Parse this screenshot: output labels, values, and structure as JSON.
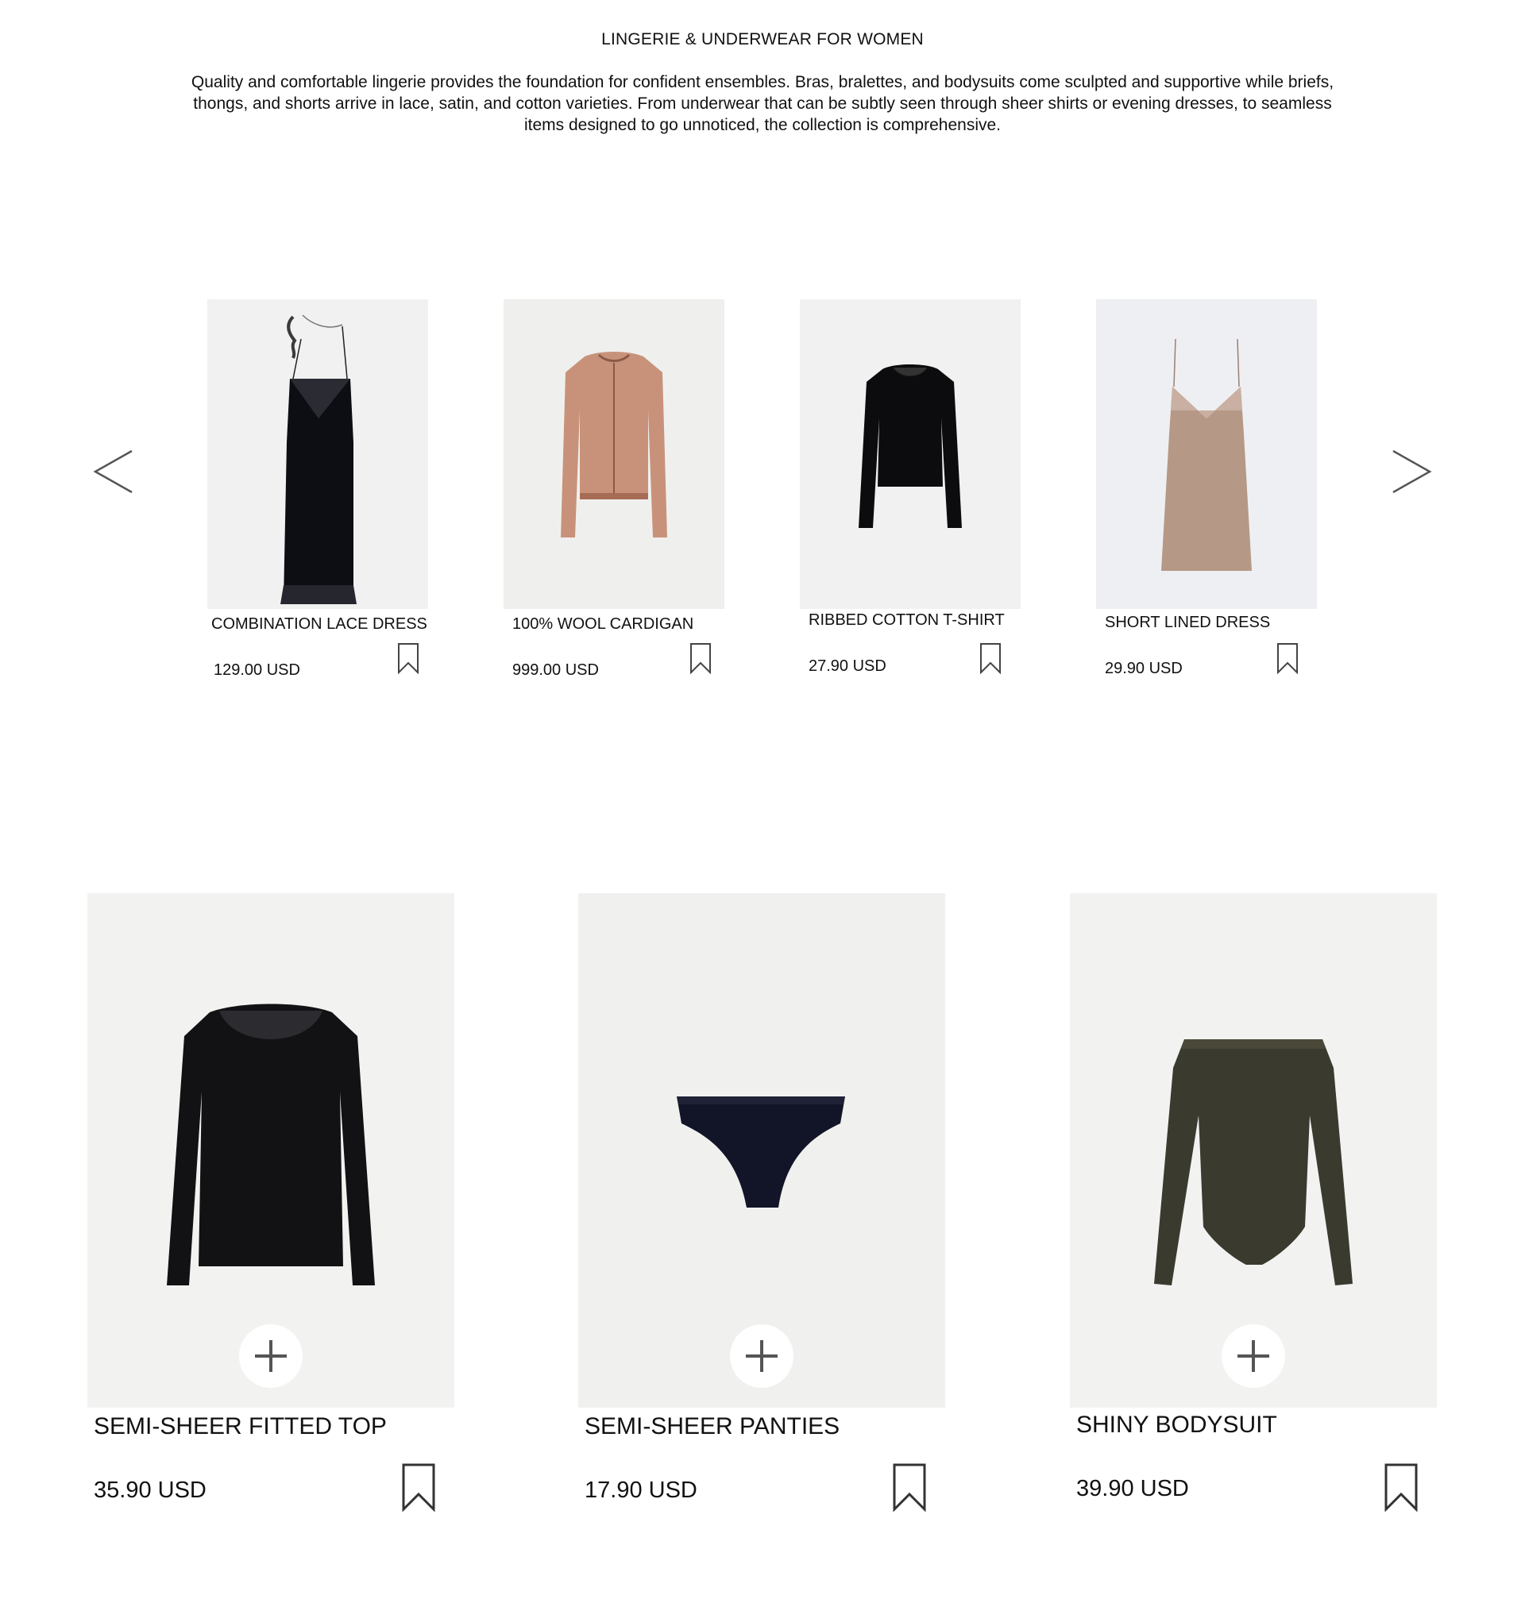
{
  "header": {
    "title": "LINGERIE & UNDERWEAR FOR WOMEN",
    "description": "Quality and comfortable lingerie provides the foundation for confident ensembles. Bras, bralettes, and bodysuits come sculpted and supportive while briefs, thongs, and shorts arrive in lace, satin, and cotton varieties. From underwear that can be subtly seen through sheer shirts or evening dresses, to seamless items designed to go unnoticed, the collection is comprehensive."
  },
  "carousel": {
    "prev_icon": "chevron-left-icon",
    "next_icon": "chevron-right-icon",
    "items": [
      {
        "name": "COMBINATION LACE DRESS",
        "price": "129.00 USD",
        "image": "black-slip-dress"
      },
      {
        "name": "100% WOOL CARDIGAN",
        "price": "999.00 USD",
        "image": "tan-cardigan"
      },
      {
        "name": "RIBBED COTTON T-SHIRT",
        "price": "27.90 USD",
        "image": "black-long-sleeve-top"
      },
      {
        "name": "SHORT LINED DRESS",
        "price": "29.90 USD",
        "image": "nude-slip-dress"
      }
    ]
  },
  "grid": {
    "items": [
      {
        "name": "SEMI-SHEER FITTED TOP",
        "price": "35.90 USD",
        "image": "black-fitted-top"
      },
      {
        "name": "SEMI-SHEER PANTIES",
        "price": "17.90 USD",
        "image": "black-panties"
      },
      {
        "name": "SHINY BODYSUIT",
        "price": "39.90 USD",
        "image": "olive-bodysuit"
      }
    ]
  },
  "colors": {
    "text": "#111111",
    "image_bg": "#f1f1f1",
    "icon_stroke": "#444444"
  }
}
